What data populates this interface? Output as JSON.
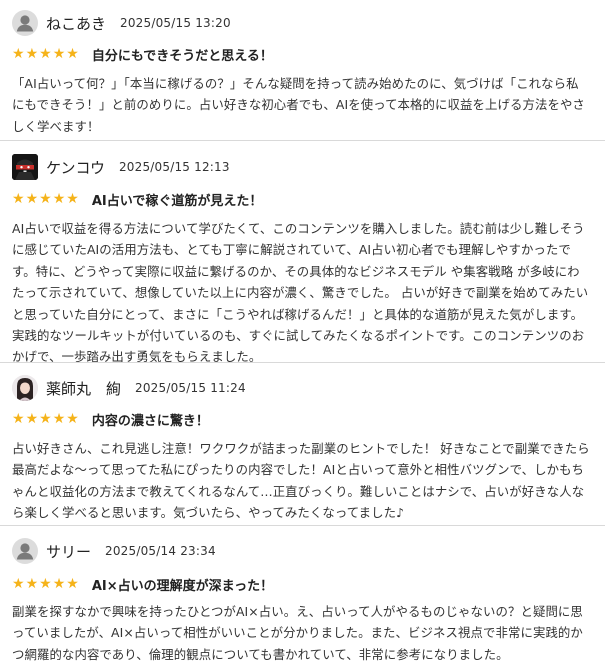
{
  "reviews": [
    {
      "user": "ねこあき",
      "date": "2025/05/15 13:20",
      "rating": 5,
      "title": "自分にもできそうだと思える！",
      "body": "「AI占いって何？」「本当に稼げるの？」そんな疑問を持って読み始めたのに、気づけば「これなら私にもできそう！」と前のめりに。占い好きな初心者でも、AIを使って本格的に収益を上げる方法をやさしく学べます！"
    },
    {
      "user": "ケンコウ",
      "date": "2025/05/15 12:13",
      "rating": 5,
      "title": "AI占いで稼ぐ道筋が見えた！",
      "body": "AI占いで収益を得る方法について学びたくて、このコンテンツを購入しました。読む前は少し難しそうに感じていたAIの活用方法も、とても丁寧に解説されていて、AI占い初心者でも理解しやすかったです。特に、どうやって実際に収益に繋げるのか、その具体的なビジネスモデル や集客戦略 が多岐にわたって示されていて、想像していた以上に内容が濃く、驚きでした。 占いが好きで副業を始めてみたいと思っていた自分にとって、まさに「こうやれば稼げるんだ！」と具体的な道筋が見えた気がします。実践的なツールキットが付いているのも、すぐに試してみたくなるポイントです。このコンテンツのおかげで、一歩踏み出す勇気をもらえました。"
    },
    {
      "user": "薬師丸　絢",
      "date": "2025/05/15 11:24",
      "rating": 5,
      "title": "内容の濃さに驚き！",
      "body": "占い好きさん、これ見逃し注意！ワクワクが詰まった副業のヒントでした！ 好きなことで副業できたら最高だよな〜って思ってた私にぴったりの内容でした！AIと占いって意外と相性バツグンで、しかもちゃんと収益化の方法まで教えてくれるなんて…正直びっくり。難しいことはナシで、占いが好きな人なら楽しく学べると思います。気づいたら、やってみたくなってました♪"
    },
    {
      "user": "サリー",
      "date": "2025/05/14 23:34",
      "rating": 5,
      "title": "AI×占いの理解度が深まった！",
      "body": "副業を探すなかで興味を持ったひとつがAI×占い。え、占いって人がやるものじゃないの？と疑問に思っていましたが、AI×占いって相性がいいことが分かりました。また、ビジネス視点で非常に実践的かつ網羅的な内容であり、倫理的観点についても書かれていて、非常に参考になりました。"
    }
  ],
  "colors": {
    "star": "#f5b31a",
    "divider": "#d9d9d9"
  },
  "icons": {
    "star": "★",
    "avatar_default": "user-silhouette-icon"
  }
}
